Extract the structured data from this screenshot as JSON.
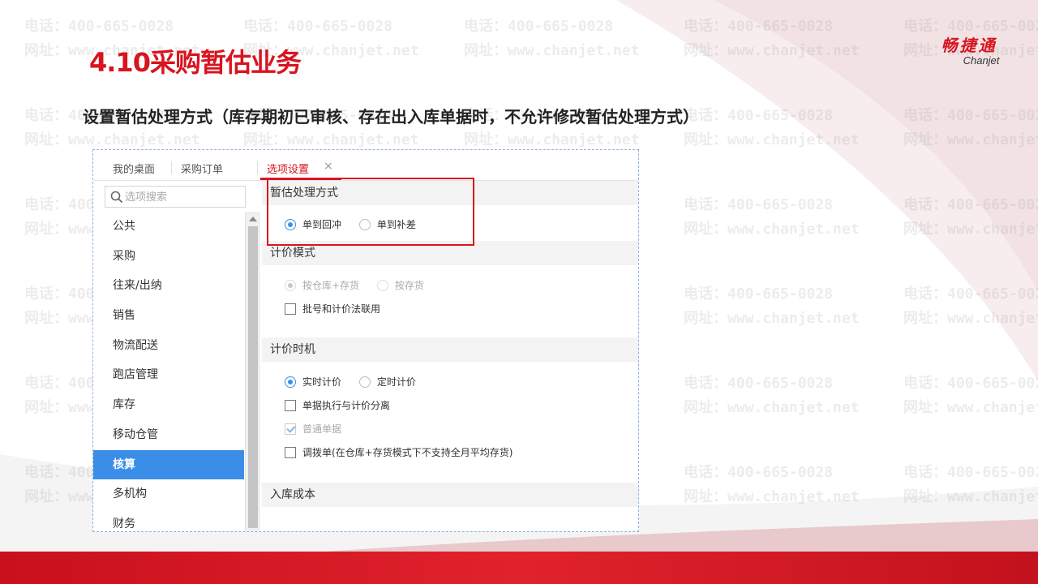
{
  "slide": {
    "title": "4.10采购暂估业务",
    "subtitle": "设置暂估处理方式（库存期初已审核、存在出入库单据时，不允许修改暂估处理方式）"
  },
  "logo": {
    "cn": "畅捷通",
    "en": "Chanjet"
  },
  "watermark": {
    "phone": "电话：400-665-0028",
    "site": "网址：www.chanjet.net"
  },
  "colors": {
    "brand_red": "#d8141f",
    "active_blue": "#3b8ee8"
  },
  "app": {
    "tabs": [
      {
        "label": "我的桌面"
      },
      {
        "label": "采购订单"
      },
      {
        "label": "选项设置",
        "active": true,
        "close": "×"
      }
    ],
    "search": {
      "placeholder": "选项搜索",
      "icon": "search-icon"
    },
    "nav": [
      {
        "label": "公共"
      },
      {
        "label": "采购"
      },
      {
        "label": "往来/出纳"
      },
      {
        "label": "销售"
      },
      {
        "label": "物流配送"
      },
      {
        "label": "跑店管理"
      },
      {
        "label": "库存"
      },
      {
        "label": "移动仓管"
      },
      {
        "label": "核算",
        "active": true
      },
      {
        "label": "多机构"
      },
      {
        "label": "财务"
      }
    ],
    "sections": {
      "estimate": {
        "title": "暂估处理方式",
        "options": [
          {
            "label": "单到回冲",
            "checked": true
          },
          {
            "label": "单到补差",
            "checked": false
          }
        ]
      },
      "pricing_mode": {
        "title": "计价模式",
        "options": [
          {
            "label": "按仓库+存货",
            "checked": true
          },
          {
            "label": "按存货",
            "checked": false
          }
        ],
        "checkbox": {
          "label": "批号和计价法联用",
          "checked": false
        }
      },
      "pricing_time": {
        "title": "计价时机",
        "options": [
          {
            "label": "实时计价",
            "checked": true
          },
          {
            "label": "定时计价",
            "checked": false
          }
        ],
        "checkboxes": [
          {
            "label": "单据执行与计价分离",
            "checked": false
          },
          {
            "label": "普通单据",
            "checked": true,
            "disabled": true
          },
          {
            "label": "调拨单(在仓库+存货模式下不支持全月平均存货)",
            "checked": false
          }
        ]
      },
      "inbound_cost": {
        "title": "入库成本"
      }
    }
  }
}
